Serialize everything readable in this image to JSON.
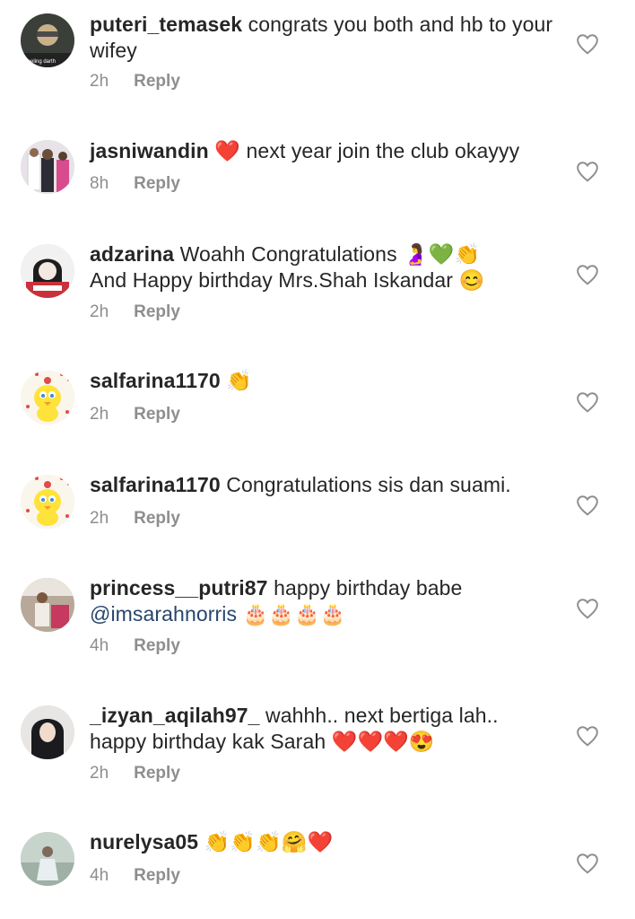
{
  "reply_label": "Reply",
  "accent_text": "#262626",
  "meta_color": "#8e8e8e",
  "mention_color": "#27466b",
  "comments": [
    {
      "username": "puteri_temasek",
      "segments": [
        " congrats you both and hb to your wifey"
      ],
      "time": "2h",
      "avatar_caption": "Feeling darth",
      "icon": "heart-outline-icon"
    },
    {
      "username": "jasniwandin",
      "segments": [
        " ❤️ next year join the club okayyy"
      ],
      "time": "8h",
      "icon": "heart-outline-icon"
    },
    {
      "username": "adzarina",
      "segments": [
        " Woahh Congratulations 🤰💚👏",
        "And Happy birthday Mrs.Shah Iskandar 😊"
      ],
      "time": "2h",
      "icon": "heart-outline-icon"
    },
    {
      "username": "salfarina1170",
      "segments": [
        " 👏"
      ],
      "time": "2h",
      "icon": "heart-outline-icon"
    },
    {
      "username": "salfarina1170",
      "segments": [
        " Congratulations sis dan suami."
      ],
      "time": "2h",
      "icon": "heart-outline-icon"
    },
    {
      "username": "princess__putri87",
      "segments": [
        " happy birthday babe"
      ],
      "mention": "@imsarahnorris",
      "after_mention": " 🎂🎂🎂🎂",
      "time": "4h",
      "icon": "heart-outline-icon"
    },
    {
      "username": "_izyan_aqilah97_",
      "segments": [
        " wahhh.. next bertiga lah..",
        "happy birthday kak Sarah ❤️❤️❤️😍"
      ],
      "time": "2h",
      "icon": "heart-outline-icon"
    },
    {
      "username": "nurelysa05",
      "segments": [
        " 👏👏👏🤗❤️"
      ],
      "time": "4h",
      "icon": "heart-outline-icon"
    }
  ]
}
